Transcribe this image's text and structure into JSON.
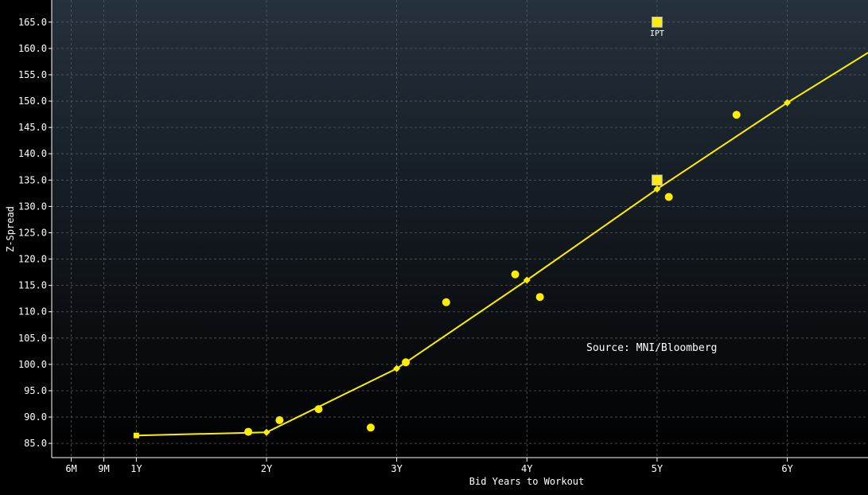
{
  "chart_data": {
    "type": "scatter",
    "xlabel": "Bid Years to Workout",
    "ylabel": "Z-Spread",
    "xlim": [
      0.35,
      6.62
    ],
    "ylim": [
      82.3,
      169.2
    ],
    "x_ticks": [
      {
        "value": 0.5,
        "label": "6M"
      },
      {
        "value": 0.75,
        "label": "9M"
      },
      {
        "value": 1,
        "label": "1Y"
      },
      {
        "value": 2,
        "label": "2Y"
      },
      {
        "value": 3,
        "label": "3Y"
      },
      {
        "value": 4,
        "label": "4Y"
      },
      {
        "value": 5,
        "label": "5Y"
      },
      {
        "value": 6,
        "label": "6Y"
      }
    ],
    "y_ticks": [
      {
        "value": 85,
        "label": "85.0"
      },
      {
        "value": 90,
        "label": "90.0"
      },
      {
        "value": 95,
        "label": "95.0"
      },
      {
        "value": 100,
        "label": "100.0"
      },
      {
        "value": 105,
        "label": "105.0"
      },
      {
        "value": 110,
        "label": "110.0"
      },
      {
        "value": 115,
        "label": "115.0"
      },
      {
        "value": 120,
        "label": "120.0"
      },
      {
        "value": 125,
        "label": "125.0"
      },
      {
        "value": 130,
        "label": "130.0"
      },
      {
        "value": 135,
        "label": "135.0"
      },
      {
        "value": 140,
        "label": "140.0"
      },
      {
        "value": 145,
        "label": "145.0"
      },
      {
        "value": 150,
        "label": "150.0"
      },
      {
        "value": 155,
        "label": "155.0"
      },
      {
        "value": 160,
        "label": "160.0"
      },
      {
        "value": 165,
        "label": "165.0"
      }
    ],
    "grid": true,
    "series": [
      {
        "kind": "curve",
        "color": "#ffee00",
        "points": [
          [
            1.0,
            86.5
          ],
          [
            2.0,
            87.1
          ],
          [
            3.0,
            99.2
          ],
          [
            4.0,
            116.0
          ],
          [
            5.0,
            133.3
          ],
          [
            6.0,
            149.7
          ],
          [
            6.62,
            159.2
          ]
        ]
      },
      {
        "kind": "bonds",
        "color": "#ffee00",
        "points": [
          [
            1.86,
            87.2
          ],
          [
            2.1,
            89.4
          ],
          [
            2.4,
            91.5
          ],
          [
            2.8,
            88.0
          ],
          [
            3.07,
            100.4
          ],
          [
            3.38,
            111.8
          ],
          [
            3.91,
            117.1
          ],
          [
            4.1,
            112.8
          ],
          [
            5.09,
            131.8
          ],
          [
            5.61,
            147.4
          ]
        ]
      },
      {
        "kind": "new-issue",
        "color": "#ffee00",
        "points": [
          [
            5.0,
            135.0
          ],
          [
            5.0,
            165.0
          ]
        ],
        "labels": [
          "",
          "IPT"
        ]
      }
    ],
    "annotations": [
      "Source: MNI/Bloomberg"
    ],
    "colors": {
      "background_top": "#25313d",
      "background_bottom": "#000000",
      "grid": "#55595e",
      "axis": "#ffffff"
    }
  }
}
